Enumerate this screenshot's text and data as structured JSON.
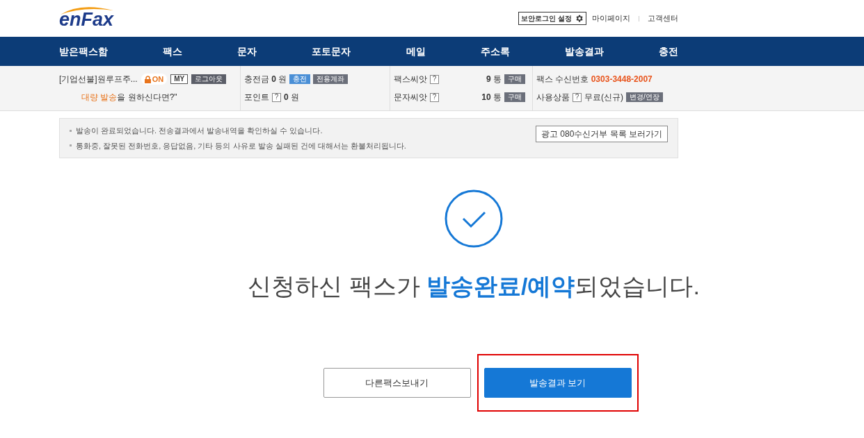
{
  "header": {
    "logo": "enFax",
    "security_button": "보안로그인 설정",
    "links": [
      "마이페이지",
      "고객센터"
    ]
  },
  "nav": [
    "받은팩스함",
    "팩스",
    "문자",
    "포토문자",
    "메일",
    "주소록",
    "발송결과",
    "충전"
  ],
  "account": {
    "company": "[기업선불]원루프주...",
    "lock": "ON",
    "my_button": "MY",
    "logout_button": "로그아웃",
    "promo_highlight": "대량 발송",
    "promo_rest": "을 원하신다면?\""
  },
  "balance": {
    "label": "충전금",
    "value": "0",
    "unit": "원",
    "buttons": [
      "충전",
      "전용계좌"
    ]
  },
  "points": {
    "label": "포인트",
    "help": "?",
    "value": "0",
    "unit": "원"
  },
  "seeds": [
    {
      "label": "팩스씨앗",
      "help": "?",
      "count": "9",
      "unit": "통",
      "button": "구매"
    },
    {
      "label": "문자씨앗",
      "help": "?",
      "count": "10",
      "unit": "통",
      "button": "구매"
    }
  ],
  "fax_number": {
    "label": "팩스 수신번호",
    "value": "0303-3448-2007"
  },
  "product": {
    "label": "사용상품",
    "help": "?",
    "value": "무료(신규)",
    "button": "변경/연장"
  },
  "notice": {
    "lines": [
      "발송이 완료되었습니다. 전송결과에서 발송내역을 확인하실 수 있습니다.",
      "통화중, 잘못된 전화번호, 응답없음, 기타 등의 사유로 발송 실패된 건에 대해서는 환불처리됩니다."
    ],
    "button": "광고 080수신거부 목록 보러가기"
  },
  "result": {
    "title_before": "신청하신 팩스가 ",
    "title_highlight": "발송완료/예약",
    "title_after": "되었습니다."
  },
  "actions": [
    {
      "label": "다른팩스보내기",
      "kind": "secondary",
      "highlighted": false
    },
    {
      "label": "발송결과 보기",
      "kind": "primary",
      "highlighted": true
    }
  ]
}
